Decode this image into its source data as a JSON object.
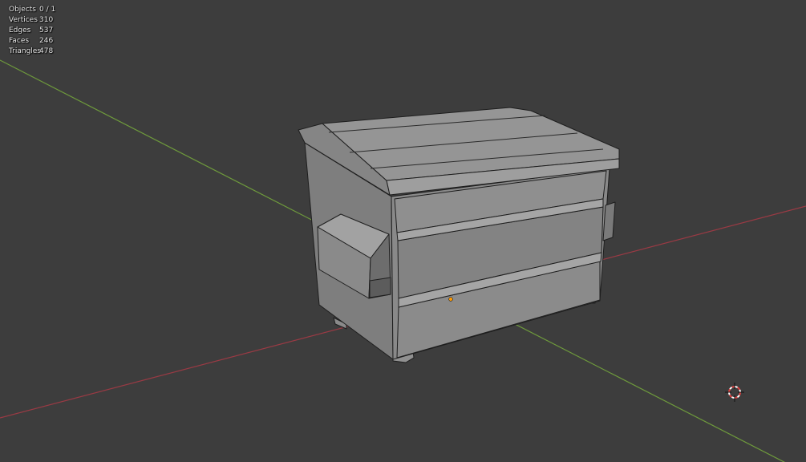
{
  "viewport": {
    "background": "#3d3d3d",
    "axis_x_color": "#9a3a44",
    "axis_y_color": "#6e9a3c"
  },
  "stats": {
    "objects": {
      "label": "Objects",
      "value": "0 / 1"
    },
    "vertices": {
      "label": "Vertices",
      "value": "310"
    },
    "edges": {
      "label": "Edges",
      "value": "537"
    },
    "faces": {
      "label": "Faces",
      "value": "246"
    },
    "triangles": {
      "label": "Triangles",
      "value": "478"
    }
  },
  "icons": {
    "cursor": "3d-cursor-icon",
    "origin": "object-origin-icon"
  }
}
